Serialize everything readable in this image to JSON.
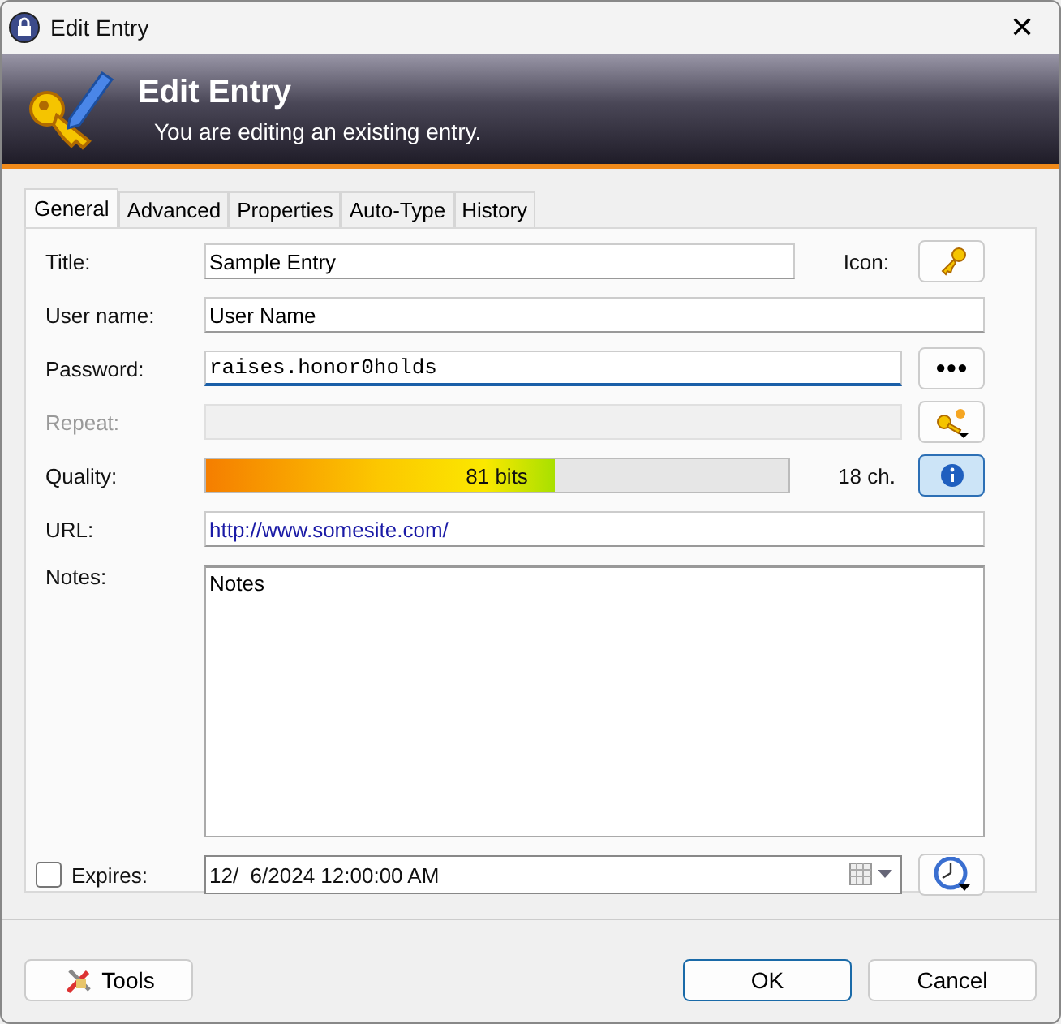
{
  "window": {
    "title": "Edit Entry",
    "close": "✕"
  },
  "banner": {
    "title": "Edit Entry",
    "subtitle": "You are editing an existing entry."
  },
  "tabs": [
    {
      "label": "General",
      "selected": true
    },
    {
      "label": "Advanced",
      "selected": false
    },
    {
      "label": "Properties",
      "selected": false
    },
    {
      "label": "Auto-Type",
      "selected": false
    },
    {
      "label": "History",
      "selected": false
    }
  ],
  "fields": {
    "title": {
      "label": "Title:",
      "value": "Sample Entry",
      "icon_label": "Icon:"
    },
    "username": {
      "label": "User name:",
      "value": "User Name"
    },
    "password": {
      "label": "Password:",
      "value": "raises.honor0holds",
      "hide_button": "●●●"
    },
    "repeat": {
      "label": "Repeat:",
      "disabled": true
    },
    "quality": {
      "label": "Quality:",
      "level": 0.6,
      "reading": "81 bits",
      "length": "18 ch."
    },
    "url": {
      "label": "URL:",
      "value": "http://www.somesite.com/"
    },
    "notes": {
      "label": "Notes:",
      "value": "Notes"
    },
    "expires": {
      "label": "Expires:",
      "checked": false,
      "value": "12/  6/2024 12:00:00 AM"
    }
  },
  "buttons": {
    "tools": "Tools",
    "ok": "OK",
    "cancel": "Cancel"
  }
}
